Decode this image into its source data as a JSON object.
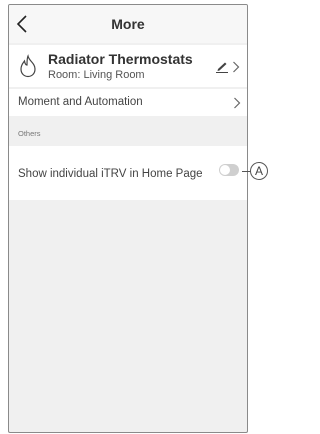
{
  "header": {
    "title": "More"
  },
  "device": {
    "name": "Radiator Thermostats",
    "room": "Room: Living Room"
  },
  "menu": {
    "moment_label": "Moment and Automation"
  },
  "section": {
    "others_label": "Others"
  },
  "setting": {
    "itrv_label": "Show individual iTRV in Home Page",
    "itrv_enabled": false
  },
  "annotation": {
    "callout_label": "A"
  },
  "icons": {
    "back": "back-chevron-icon",
    "device": "flame-icon",
    "edit": "pencil-icon",
    "chevron": "chevron-right-icon"
  },
  "colors": {
    "background": "#f0f0f0",
    "toggle_off": "#cfcfcf"
  }
}
